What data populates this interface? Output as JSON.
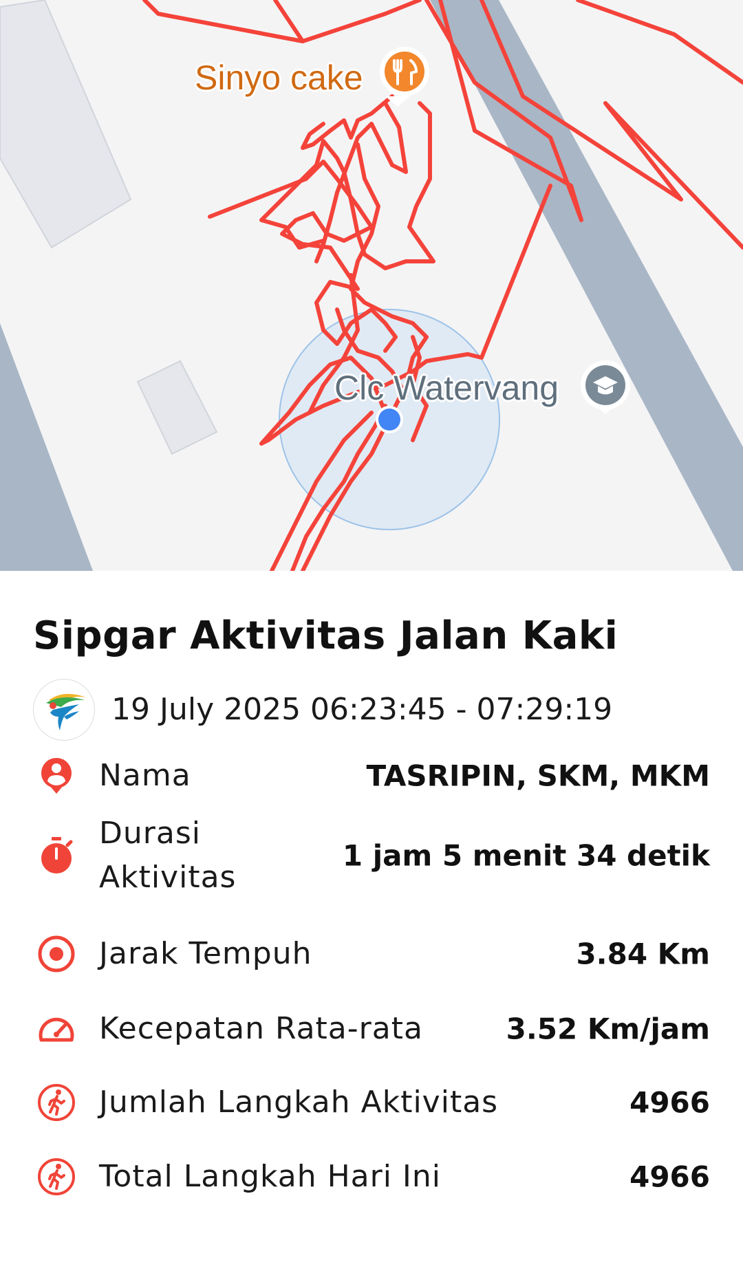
{
  "map": {
    "poi_food_label": "Sinyo cake",
    "poi_school_label": "Clc Watervang"
  },
  "activity": {
    "title": "Sipgar Aktivitas Jalan Kaki",
    "datetime": "19 July 2025 06:23:45 - 07:29:19"
  },
  "stats": [
    {
      "icon": "person-icon",
      "label": "Nama",
      "value": "TASRIPIN, SKM, MKM"
    },
    {
      "icon": "stopwatch-icon",
      "label": "Durasi Aktivitas",
      "value": "1 jam 5 menit 34 detik"
    },
    {
      "icon": "target-icon",
      "label": "Jarak Tempuh",
      "value": "3.84 Km"
    },
    {
      "icon": "speedometer-icon",
      "label": "Kecepatan Rata-rata",
      "value": "3.52 Km/jam"
    },
    {
      "icon": "walking-icon",
      "label": "Jumlah Langkah Aktivitas",
      "value": "4966"
    },
    {
      "icon": "walking-icon",
      "label": "Total Langkah Hari Ini",
      "value": "4966"
    }
  ],
  "colors": {
    "accent": "#f04438",
    "route": "#f4433a",
    "road": "#a9b6c6",
    "location_dot": "#4285f4",
    "food_poi": "#f2872c",
    "school_poi": "#7b8a97"
  }
}
